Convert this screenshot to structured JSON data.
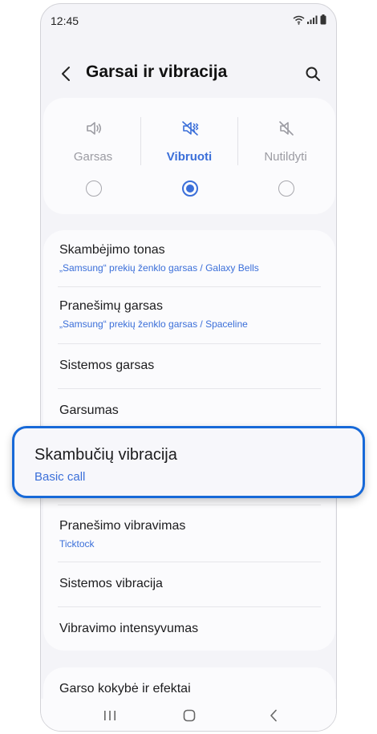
{
  "status_bar": {
    "time": "12:45"
  },
  "header": {
    "title": "Garsai ir vibracija"
  },
  "sound_modes": [
    {
      "label": "Garsas",
      "icon": "speaker-icon",
      "selected": false
    },
    {
      "label": "Vibruoti",
      "icon": "vibrate-icon",
      "selected": true
    },
    {
      "label": "Nutildyti",
      "icon": "mute-icon",
      "selected": false
    }
  ],
  "settings": [
    {
      "title": "Skambėjimo tonas",
      "subtitle": "„Samsung“ prekių ženklo garsas / Galaxy Bells"
    },
    {
      "title": "Pranešimų garsas",
      "subtitle": "„Samsung“ prekių ženklo garsas / Spaceline"
    },
    {
      "title": "Sistemos garsas",
      "subtitle": ""
    },
    {
      "title": "Garsumas",
      "subtitle": ""
    },
    {
      "title": "Skambučių vibracija",
      "subtitle": "Basic call"
    },
    {
      "title": "Pranešimo vibravimas",
      "subtitle": "Ticktock"
    },
    {
      "title": "Sistemos vibracija",
      "subtitle": ""
    },
    {
      "title": "Vibravimo intensyvumas",
      "subtitle": ""
    }
  ],
  "more": {
    "title": "Garso kokybė ir efektai"
  },
  "colors": {
    "accent": "#3b6fd9",
    "highlight_border": "#1769d8"
  }
}
